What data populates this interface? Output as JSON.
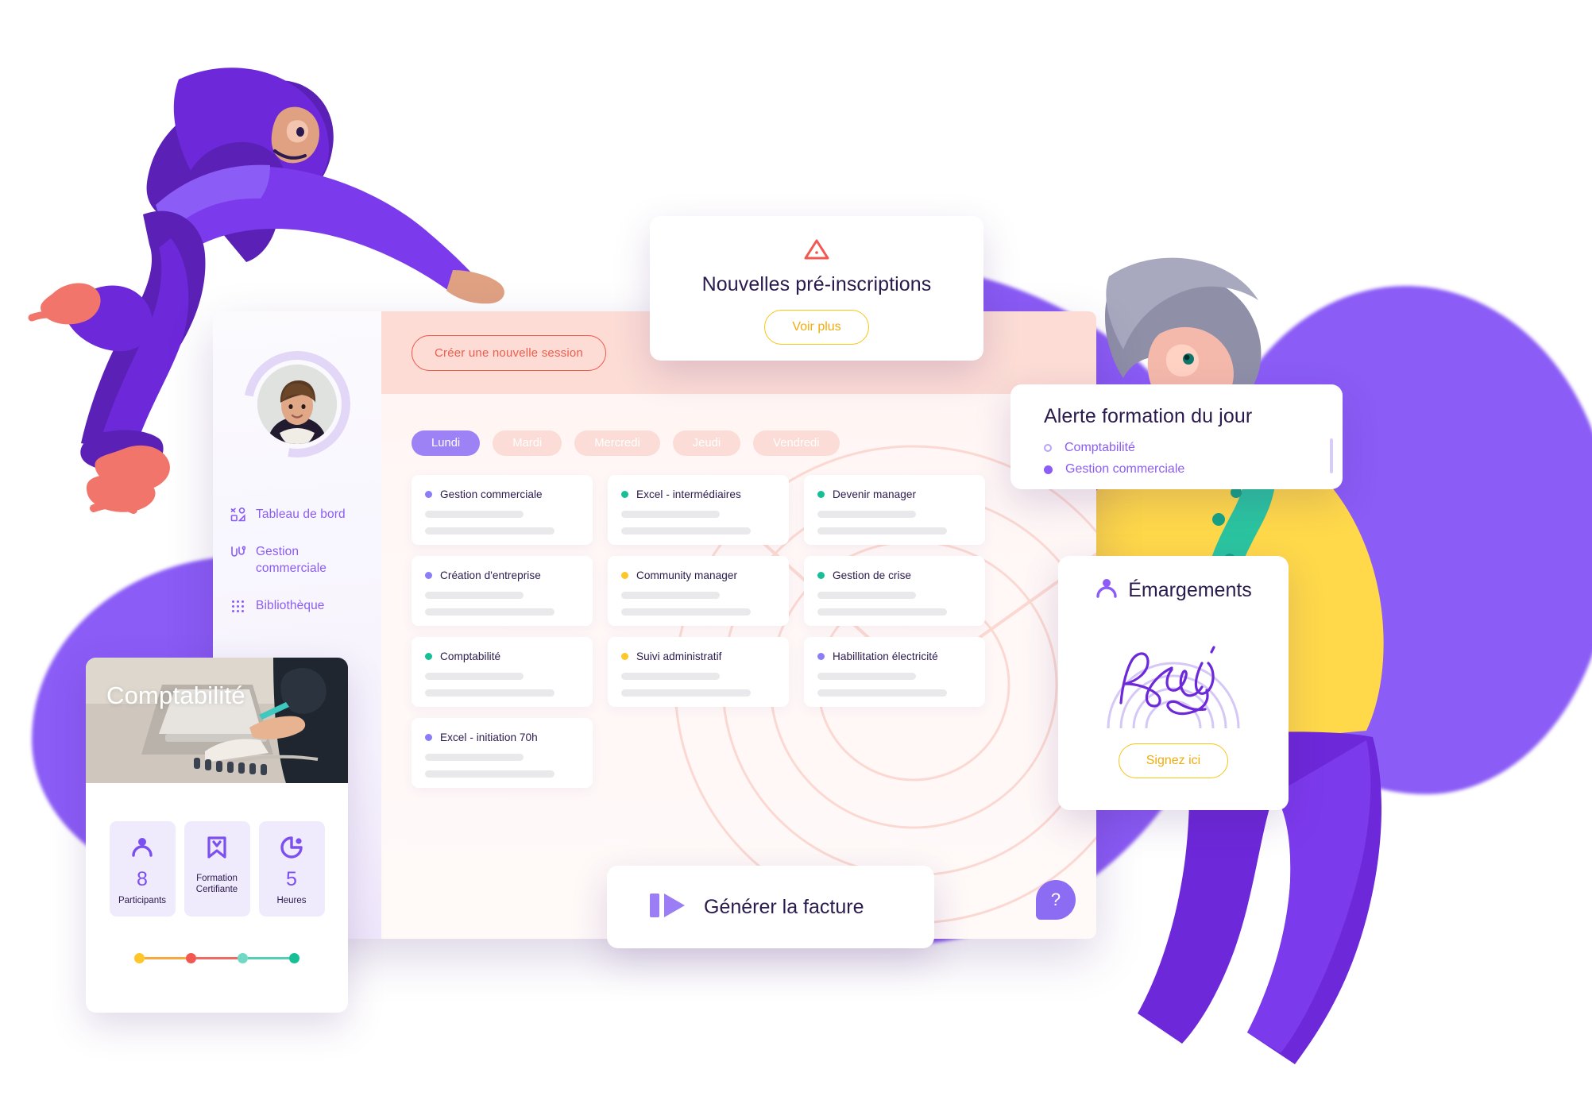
{
  "sidebar": {
    "avatar_name": "user-avatar",
    "items": [
      {
        "label": "Tableau de bord",
        "icon": "dashboard-icon"
      },
      {
        "label": "Gestion commerciale",
        "icon": "flow-icon"
      },
      {
        "label": "Bibliothèque",
        "icon": "grid-dots-icon"
      }
    ]
  },
  "topbar": {
    "new_session_label": "Créer une nouvelle session"
  },
  "days": [
    {
      "label": "Lundi",
      "active": true
    },
    {
      "label": "Mardi",
      "active": false
    },
    {
      "label": "Mercredi",
      "active": false
    },
    {
      "label": "Jeudi",
      "active": false
    },
    {
      "label": "Vendredi",
      "active": false
    }
  ],
  "colors": {
    "purple": "#8b5cf6",
    "light_purple": "#9d82f5",
    "green": "#17bf96",
    "yellow": "#ffc629",
    "red": "#ef5d4e",
    "pink_bg": "#fcdcd5",
    "dark_text": "#2b1a4d"
  },
  "cards": [
    {
      "title": "Gestion commerciale",
      "dot": "#8b7cf8"
    },
    {
      "title": "Excel - intermédiaires",
      "dot": "#17bf96"
    },
    {
      "title": "Devenir manager",
      "dot": "#17bf96"
    },
    {
      "title": "Création d'entreprise",
      "dot": "#8b7cf8"
    },
    {
      "title": "Community manager",
      "dot": "#ffc629"
    },
    {
      "title": "Gestion de crise",
      "dot": "#17bf96"
    },
    {
      "title": "Comptabilité",
      "dot": "#17bf96"
    },
    {
      "title": "Suivi administratif",
      "dot": "#ffc629"
    },
    {
      "title": "Habillitation électricité",
      "dot": "#8b7cf8"
    },
    {
      "title": "Excel - initiation 70h",
      "dot": "#8b7cf8"
    }
  ],
  "help_button": {
    "label": "?"
  },
  "preinscriptions": {
    "icon": "warning-triangle-icon",
    "title": "Nouvelles pré-inscriptions",
    "button_label": "Voir plus"
  },
  "alerte": {
    "title": "Alerte formation du jour",
    "items": [
      {
        "label": "Comptabilité",
        "marker": "ring"
      },
      {
        "label": "Gestion commerciale",
        "marker": "full"
      }
    ]
  },
  "emargements": {
    "icon": "person-icon",
    "title": "Émargements",
    "signature": "Regis",
    "button_label": "Signez ici"
  },
  "facture": {
    "icon": "play-icon",
    "title": "Générer la facture"
  },
  "comptabilite": {
    "title": "Comptabilité",
    "stats": [
      {
        "icon": "person-icon",
        "value": "8",
        "label": "Participants"
      },
      {
        "icon": "bookmark-check-icon",
        "value": "",
        "label": "Formation Certifiante"
      },
      {
        "icon": "pie-clock-icon",
        "value": "5",
        "label": "Heures"
      }
    ],
    "progress": [
      {
        "dot": "#ffc629"
      },
      {
        "dot": "#f2584f"
      },
      {
        "dot": "#6fd9c4"
      },
      {
        "dot": "#17bf96"
      }
    ]
  }
}
